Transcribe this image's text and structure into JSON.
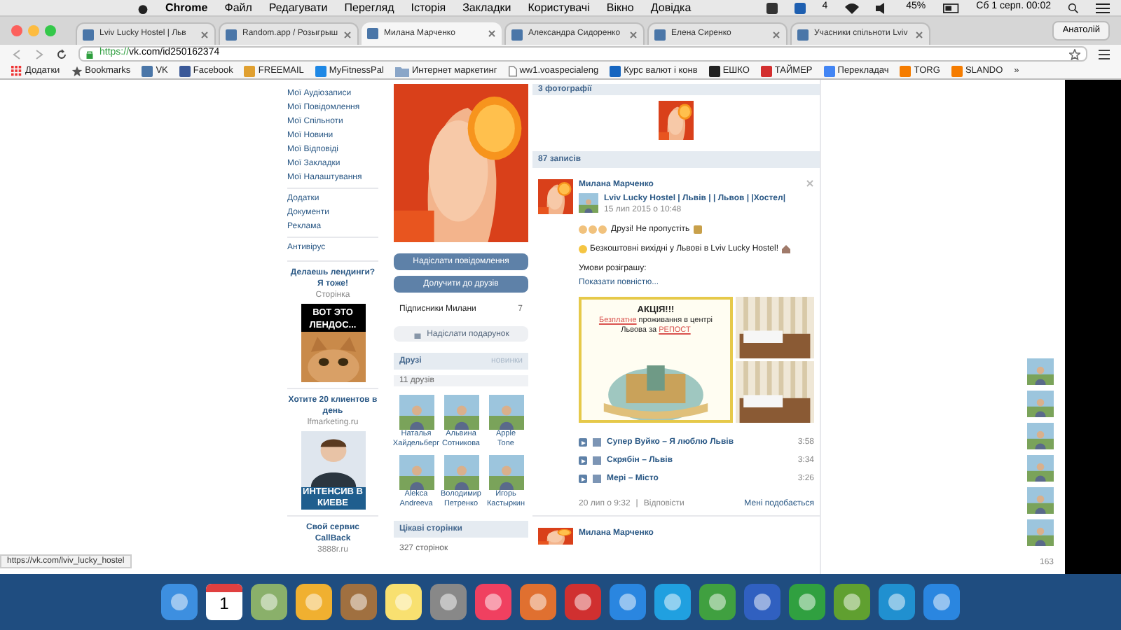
{
  "menubar": {
    "app": "Chrome",
    "items": [
      "Файл",
      "Редагувати",
      "Перегляд",
      "Історія",
      "Закладки",
      "Користувачі",
      "Вікно",
      "Довідка"
    ],
    "badge": "4",
    "battery": "45%",
    "clock": "Сб 1 серп. 00:02"
  },
  "tabs": [
    {
      "title": "Lviv Lucky Hostel | Льв",
      "selected": false
    },
    {
      "title": "Random.app / Розыгрыш",
      "selected": false
    },
    {
      "title": "Милана Марченко",
      "selected": true
    },
    {
      "title": "Александра Сидоренко",
      "selected": false
    },
    {
      "title": "Елена Сиренко",
      "selected": false
    },
    {
      "title": "Учасники спільноти Lviv",
      "selected": false
    }
  ],
  "profile": "Анатолій",
  "address": {
    "scheme": "https://",
    "rest": "vk.com/id250162374"
  },
  "bookmarks": [
    {
      "label": "Додатки",
      "kind": "apps"
    },
    {
      "label": "Bookmarks",
      "kind": "star"
    },
    {
      "label": "VK",
      "kind": "site",
      "color": "#4a76a8"
    },
    {
      "label": "Facebook",
      "kind": "site",
      "color": "#3b5998"
    },
    {
      "label": "FREEMAIL",
      "kind": "site",
      "color": "#e0a030"
    },
    {
      "label": "MyFitnessPal",
      "kind": "site",
      "color": "#1e88e5"
    },
    {
      "label": "Интернет маркетинг",
      "kind": "folder"
    },
    {
      "label": "ww1.voaspecialeng",
      "kind": "page"
    },
    {
      "label": "Курс валют і конв",
      "kind": "site",
      "color": "#1565c0"
    },
    {
      "label": "ЕШКО",
      "kind": "site",
      "color": "#222222"
    },
    {
      "label": "ТАЙМЕР",
      "kind": "site",
      "color": "#d32f2f"
    },
    {
      "label": "Перекладач",
      "kind": "site",
      "color": "#4285f4"
    },
    {
      "label": "TORG",
      "kind": "site",
      "color": "#f57c00"
    },
    {
      "label": "SLANDO",
      "kind": "site",
      "color": "#f57c00"
    },
    {
      "label": "»",
      "kind": "more"
    }
  ],
  "nav": [
    [
      "Мої Аудіозаписи",
      "Мої Повідомлення",
      "Мої Спільноти",
      "Мої Новини",
      "Мої Відповіді",
      "Мої Закладки",
      "Мої Налаштування"
    ],
    [
      "Додатки",
      "Документи",
      "Реклама"
    ],
    [
      "Антивірус"
    ]
  ],
  "ads": [
    {
      "title": "Делаешь лендинги? Я тоже!",
      "source": "Сторінка",
      "banner": "ВОТ ЭТО ЛЕНДОС...",
      "kind": "cat"
    },
    {
      "title": "Хотите 20 клиентов в день",
      "source": "lfmarketing.ru",
      "banner": "ИНТЕНСИВ В КИЕВЕ",
      "kind": "person"
    },
    {
      "title": "Свой сервис CallBack",
      "source": "3888r.ru"
    }
  ],
  "actions": [
    "Надіслати повідомлення",
    "Долучити до друзів"
  ],
  "followers": {
    "label": "Підписники Милани",
    "count": "7"
  },
  "gift": "Надіслати подарунок",
  "friends": {
    "title": "Друзі",
    "more": "новинки",
    "count": "11 друзів",
    "people": [
      {
        "first": "Наталья",
        "last": "Хайдельберг"
      },
      {
        "first": "Альвина",
        "last": "Сотникова"
      },
      {
        "first": "Apple",
        "last": "Tone"
      },
      {
        "first": "Alekса",
        "last": "Andreeva"
      },
      {
        "first": "Володимир",
        "last": "Петренко"
      },
      {
        "first": "Игорь",
        "last": "Кастыркин"
      }
    ]
  },
  "pages": {
    "title": "Цікаві сторінки",
    "count": "327 сторінок"
  },
  "wall": {
    "photos": "3 фотографії",
    "posts": "87 записів",
    "post": {
      "author": "Милана Марченко",
      "source": "Lviv Lucky Hostel | Львів | | Львов | |Хостел|",
      "date": "15 лип 2015 о 10:48",
      "line1": "Друзі! Не пропустіть",
      "line2": "Безкоштовні вихідні у Львові в Lviv Lucky Hostel!",
      "line3": "Умови розіграшу:",
      "more": "Показати повністю...",
      "poster": {
        "title": "АКЦІЯ!!!",
        "parts": [
          {
            "text": "Безплатне",
            "highlight": true
          },
          {
            "text": " проживання в центрі Львова за ",
            "highlight": false
          },
          {
            "text": "РЕПОСТ",
            "highlight": true
          }
        ]
      },
      "tracks": [
        {
          "title": "Супер Вуйко – Я люблю Львів",
          "duration": "3:58"
        },
        {
          "title": "Скрябін – Львів",
          "duration": "3:34"
        },
        {
          "title": "Мері – Місто",
          "duration": "3:26"
        }
      ],
      "time": "20 лип о 9:32",
      "separator": "|",
      "reply": "Відповісти",
      "like": "Мені подобається"
    },
    "next_author": "Милана Марченко"
  },
  "online": "163",
  "status_url": "https://vk.com/lviv_lucky_hostel",
  "dock": {
    "calendar_day": "1"
  }
}
